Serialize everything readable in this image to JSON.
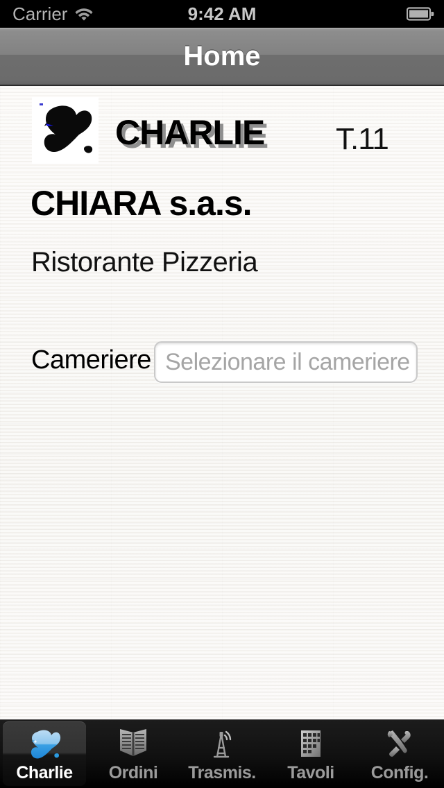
{
  "status_bar": {
    "carrier": "Carrier",
    "wifi_icon": "wifi-icon",
    "time": "9:42 AM",
    "battery_icon": "battery-full-icon"
  },
  "nav_bar": {
    "title": "Home"
  },
  "content": {
    "logo_icon": "charlie-logo-black-icon",
    "brand_line1": "CHARLIE",
    "brand_line2": "CHIARA s.a.s.",
    "brand_subtitle": "Ristorante Pizzeria",
    "table_badge": "T.11",
    "waiter_form": {
      "label": "Cameriere",
      "value": "",
      "placeholder": "Selezionare il cameriere"
    }
  },
  "tab_bar": {
    "selected": "Charlie",
    "items": [
      {
        "label": "Charlie",
        "icon": "charlie-blob-icon",
        "active": true
      },
      {
        "label": "Ordini",
        "icon": "open-book-icon",
        "active": false
      },
      {
        "label": "Trasmis.",
        "icon": "antenna-tower-icon",
        "active": false
      },
      {
        "label": "Tavoli",
        "icon": "building-grid-icon",
        "active": false
      },
      {
        "label": "Config.",
        "icon": "tools-icon",
        "active": false
      }
    ]
  },
  "colors": {
    "accent_blue": "#6cb9e8",
    "tab_inactive": "#9b9b9b",
    "tab_active_text": "#ffffff",
    "nav_bar_gray": "#828282",
    "paper_bg": "#f7f5f2",
    "brand_shadow_gray": "#8f8f8f"
  }
}
